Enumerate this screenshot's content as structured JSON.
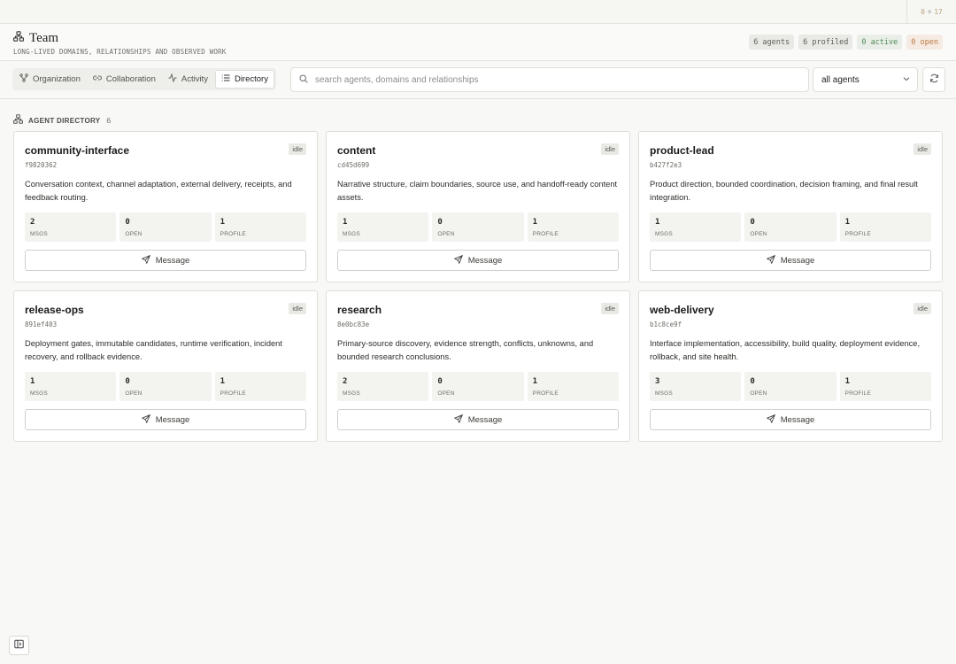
{
  "topbar": {
    "counter_left": "0",
    "counter_right": "17"
  },
  "header": {
    "title": "Team",
    "subtitle": "LONG-LIVED DOMAINS, RELATIONSHIPS AND OBSERVED WORK",
    "badges": {
      "agents": "6 agents",
      "profiled": "6 profiled",
      "active": "0 active",
      "open": "0 open"
    }
  },
  "tabs": [
    {
      "label": "Organization",
      "icon": "org-icon"
    },
    {
      "label": "Collaboration",
      "icon": "link-icon"
    },
    {
      "label": "Activity",
      "icon": "activity-icon"
    },
    {
      "label": "Directory",
      "icon": "list-icon",
      "selected": true
    }
  ],
  "search": {
    "placeholder": "search agents, domains and relationships",
    "value": ""
  },
  "filter": {
    "selected": "all agents"
  },
  "section": {
    "label": "AGENT DIRECTORY",
    "count": "6"
  },
  "stat_labels": {
    "msgs": "MSGS",
    "open": "OPEN",
    "profile": "PROFILE"
  },
  "message_label": "Message",
  "agents": [
    {
      "name": "community-interface",
      "status": "idle",
      "hash": "f9820362",
      "desc": "Conversation context, channel adaptation, external delivery, receipts, and feedback routing.",
      "msgs": "2",
      "open": "0",
      "profile": "1"
    },
    {
      "name": "content",
      "status": "idle",
      "hash": "cd45d699",
      "desc": "Narrative structure, claim boundaries, source use, and handoff-ready content assets.",
      "msgs": "1",
      "open": "0",
      "profile": "1"
    },
    {
      "name": "product-lead",
      "status": "idle",
      "hash": "b427f2e3",
      "desc": "Product direction, bounded coordination, decision framing, and final result integration.",
      "msgs": "1",
      "open": "0",
      "profile": "1"
    },
    {
      "name": "release-ops",
      "status": "idle",
      "hash": "891ef403",
      "desc": "Deployment gates, immutable candidates, runtime verification, incident recovery, and rollback evidence.",
      "msgs": "1",
      "open": "0",
      "profile": "1"
    },
    {
      "name": "research",
      "status": "idle",
      "hash": "8e0bc83e",
      "desc": "Primary-source discovery, evidence strength, conflicts, unknowns, and bounded research conclusions.",
      "msgs": "2",
      "open": "0",
      "profile": "1"
    },
    {
      "name": "web-delivery",
      "status": "idle",
      "hash": "b1c8ce9f",
      "desc": "Interface implementation, accessibility, build quality, deployment evidence, rollback, and site health.",
      "msgs": "3",
      "open": "0",
      "profile": "1"
    }
  ]
}
